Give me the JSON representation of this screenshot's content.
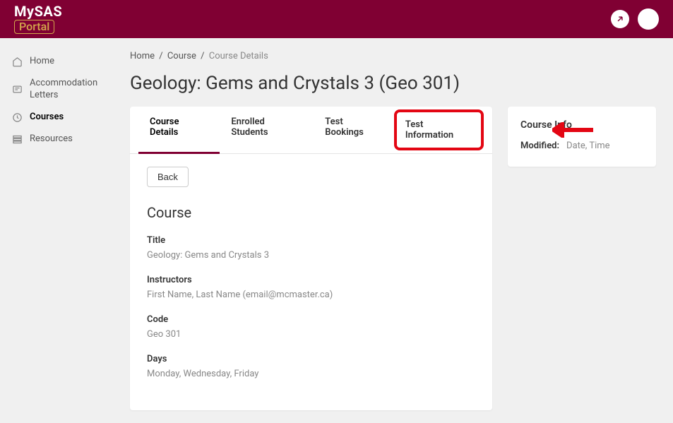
{
  "logo": {
    "top": "MySAS",
    "bottom": "Portal"
  },
  "sidebar": {
    "items": [
      {
        "label": "Home"
      },
      {
        "label": "Accommodation Letters"
      },
      {
        "label": "Courses"
      },
      {
        "label": "Resources"
      }
    ]
  },
  "breadcrumb": {
    "items": [
      "Home",
      "Course",
      "Course Details"
    ]
  },
  "page_title": "Geology: Gems and Crystals 3 (Geo 301)",
  "tabs": [
    {
      "label": "Course Details"
    },
    {
      "label": "Enrolled Students"
    },
    {
      "label": "Test Bookings"
    },
    {
      "label": "Test Information"
    }
  ],
  "back_label": "Back",
  "course_section_title": "Course",
  "course_fields": [
    {
      "label": "Title",
      "value": "Geology: Gems and Crystals 3"
    },
    {
      "label": "Instructors",
      "value": "First Name, Last Name (email@mcmaster.ca)"
    },
    {
      "label": "Code",
      "value": "Geo 301"
    },
    {
      "label": "Days",
      "value": "Monday, Wednesday, Friday"
    }
  ],
  "course_info": {
    "title": "Course Info",
    "modified_label": "Modified:",
    "modified_value": "Date, Time"
  }
}
